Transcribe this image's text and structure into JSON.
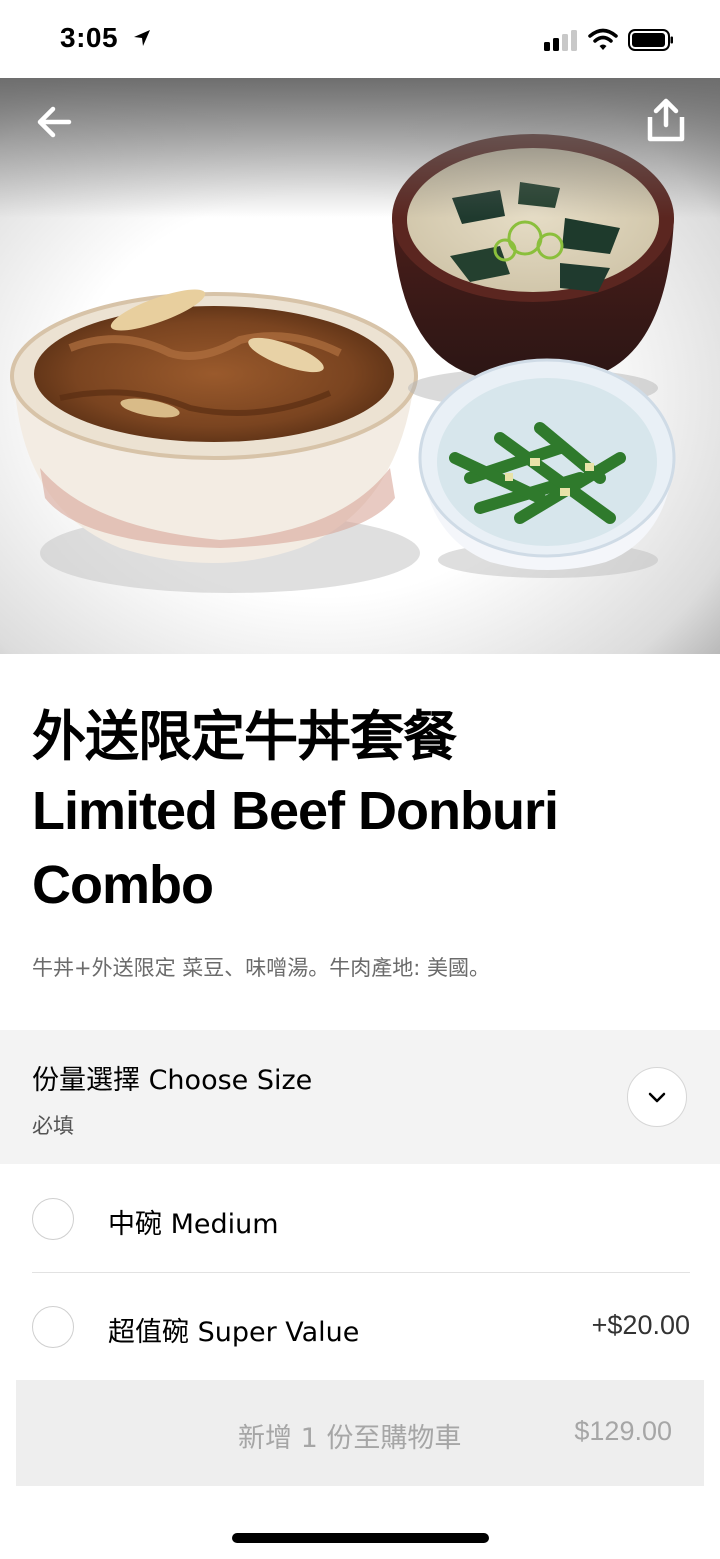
{
  "status_bar": {
    "time": "3:05"
  },
  "item": {
    "title_zh": "外送限定牛丼套餐",
    "title_en_line1": "Limited Beef Donburi",
    "title_en_line2": "Combo",
    "description": "牛丼+外送限定 菜豆、味噌湯。牛肉產地: 美國。"
  },
  "options_group": {
    "title": "份量選擇 Choose Size",
    "subtitle": "必填",
    "options": [
      {
        "label": "中碗 Medium",
        "price": ""
      },
      {
        "label": "超值碗 Super Value",
        "price": "+$20.00"
      }
    ]
  },
  "cart_button": {
    "label": "新增 1 份至購物車",
    "price": "$129.00"
  },
  "icons": {
    "back": "arrow-left-icon",
    "share": "share-icon",
    "collapse": "chevron-down-icon"
  }
}
